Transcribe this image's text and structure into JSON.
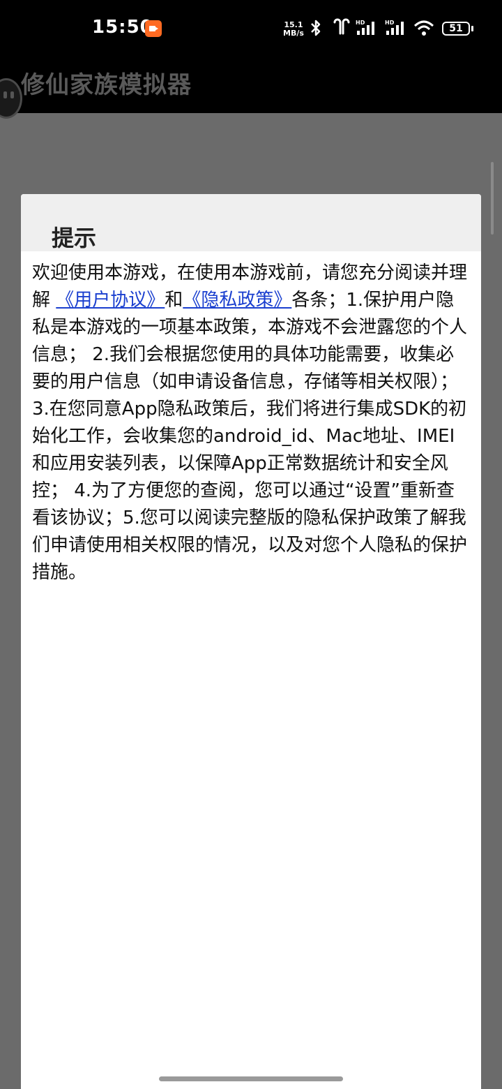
{
  "status_bar": {
    "time": "15:50",
    "net_speed_value": "15.1",
    "net_speed_unit": "MB/s",
    "battery": "51",
    "icons": [
      "recording-icon",
      "bluetooth-icon",
      "earbuds-icon",
      "signal-hd-1-icon",
      "signal-hd-2-icon",
      "wifi-icon",
      "battery-icon"
    ]
  },
  "app_bar": {
    "title": "修仙家族模拟器"
  },
  "dialog": {
    "title": "提示",
    "text_intro": "欢迎使用本游戏，在使用本游戏前，请您充分阅读并理解",
    "link_user_agreement": "《用户协议》",
    "text_and": "和",
    "link_privacy_policy": "《隐私政策》",
    "text_body": "各条；1.保护用户隐私是本游戏的一项基本政策，本游戏不会泄露您的个人信息； 2.我们会根据您使用的具体功能需要，收集必要的用户信息（如申请设备信息，存储等相关权限）；3.在您同意App隐私政策后，我们将进行集成SDK的初始化工作，会收集您的android_id、Mac地址、IMEI和应用安装列表，以保障App正常数据统计和安全风控； 4.为了方便您的查阅，您可以通过“设置”重新查看该协议；5.您可以阅读完整版的隐私保护政策了解我们申请使用相关权限的情况，以及对您个人隐私的保护措施。"
  },
  "colors": {
    "status_bar_bg": "#000000",
    "overlay": "#6b6b6b",
    "dialog_header_bg": "#efefef",
    "link": "#1a3fcf",
    "recording_badge": "#ff6a22"
  }
}
